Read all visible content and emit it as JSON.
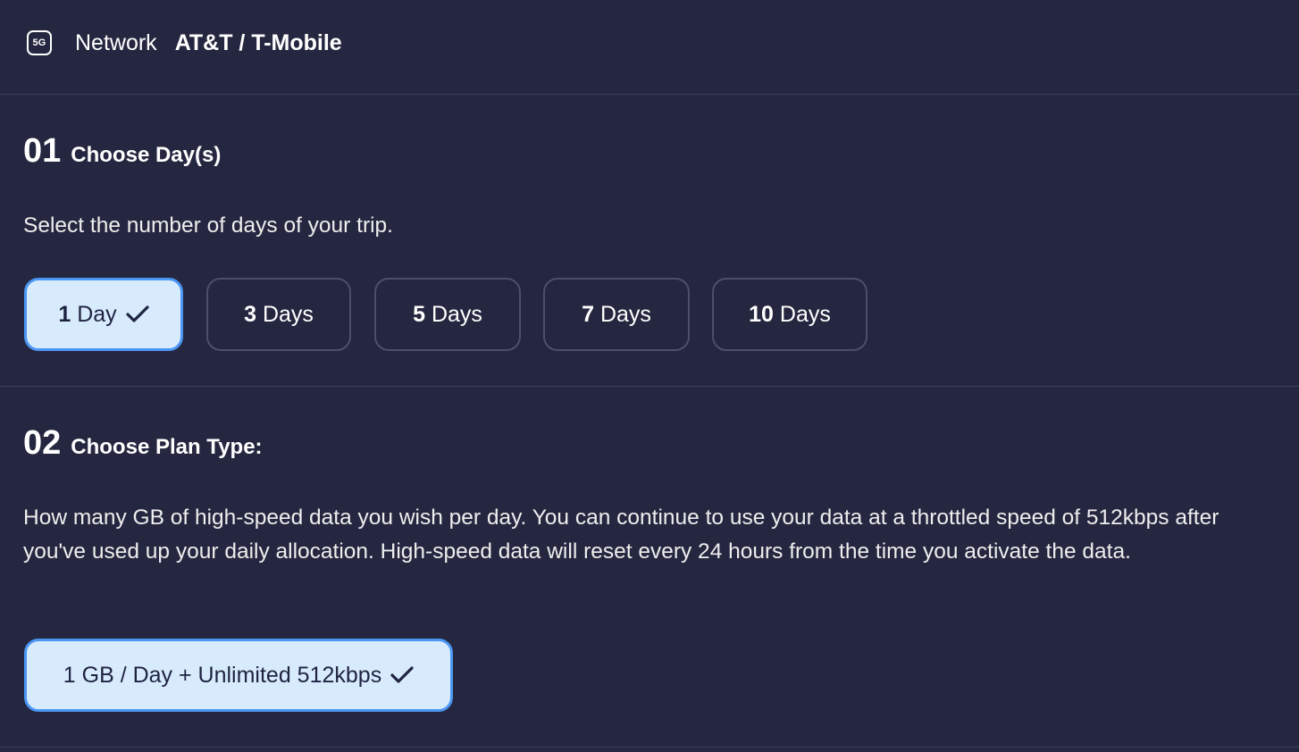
{
  "network": {
    "icon": "5g-icon",
    "icon_text": "5G",
    "label": "Network",
    "value": "AT&T / T-Mobile"
  },
  "days_section": {
    "number": "01",
    "title": "Choose Day(s)",
    "description": "Select the number of days of your trip.",
    "options": [
      {
        "num": "1",
        "unit": "Day",
        "selected": true
      },
      {
        "num": "3",
        "unit": "Days",
        "selected": false
      },
      {
        "num": "5",
        "unit": "Days",
        "selected": false
      },
      {
        "num": "7",
        "unit": "Days",
        "selected": false
      },
      {
        "num": "10",
        "unit": "Days",
        "selected": false
      }
    ]
  },
  "plan_section": {
    "number": "02",
    "title": "Choose Plan Type:",
    "description": "How many GB of high-speed data you wish per day. You can continue to use your data at a throttled speed of 512kbps after you've used up your daily allocation. High-speed data will reset every 24 hours from the time you activate the data.",
    "options": [
      {
        "label": "1 GB / Day + Unlimited 512kbps",
        "selected": true
      }
    ]
  },
  "colors": {
    "background": "#252740",
    "selected_fill": "#d7ebfd",
    "selected_border": "#4b96f3",
    "option_border": "#4c4f6a"
  }
}
